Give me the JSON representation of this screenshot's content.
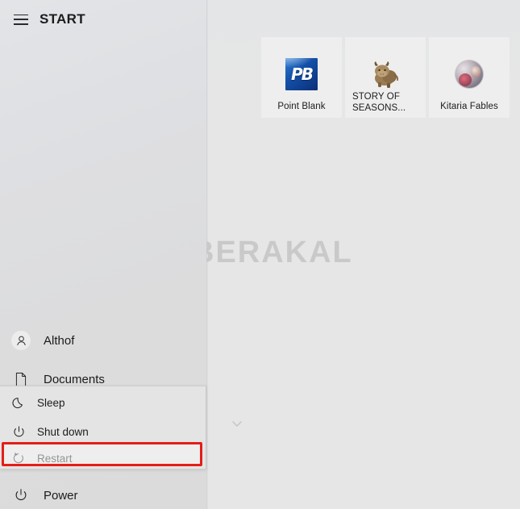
{
  "window": {
    "title": "START",
    "menu_icon": "hamburger-icon",
    "watermark": "BERAKAL",
    "accent_highlight_color": "#e41d18"
  },
  "tiles": [
    {
      "label": "Point Blank",
      "icon": "point-blank-icon",
      "icon_text": "PB"
    },
    {
      "label": "STORY OF SEASONS...",
      "icon": "story-of-seasons-cow-icon"
    },
    {
      "label": "Kitaria Fables",
      "icon": "kitaria-fables-icon"
    }
  ],
  "sidebar": {
    "items": [
      {
        "label": "Althof",
        "icon": "user-account-icon"
      },
      {
        "label": "Documents",
        "icon": "document-icon"
      },
      {
        "label": "Power",
        "icon": "power-icon"
      }
    ]
  },
  "power_menu": {
    "items": [
      {
        "label": "Sleep",
        "icon": "moon-icon"
      },
      {
        "label": "Shut down",
        "icon": "power-icon"
      },
      {
        "label": "Restart",
        "icon": "restart-icon",
        "highlighted": true
      }
    ]
  },
  "main_panel": {
    "collapse_icon": "chevron-down-icon"
  }
}
